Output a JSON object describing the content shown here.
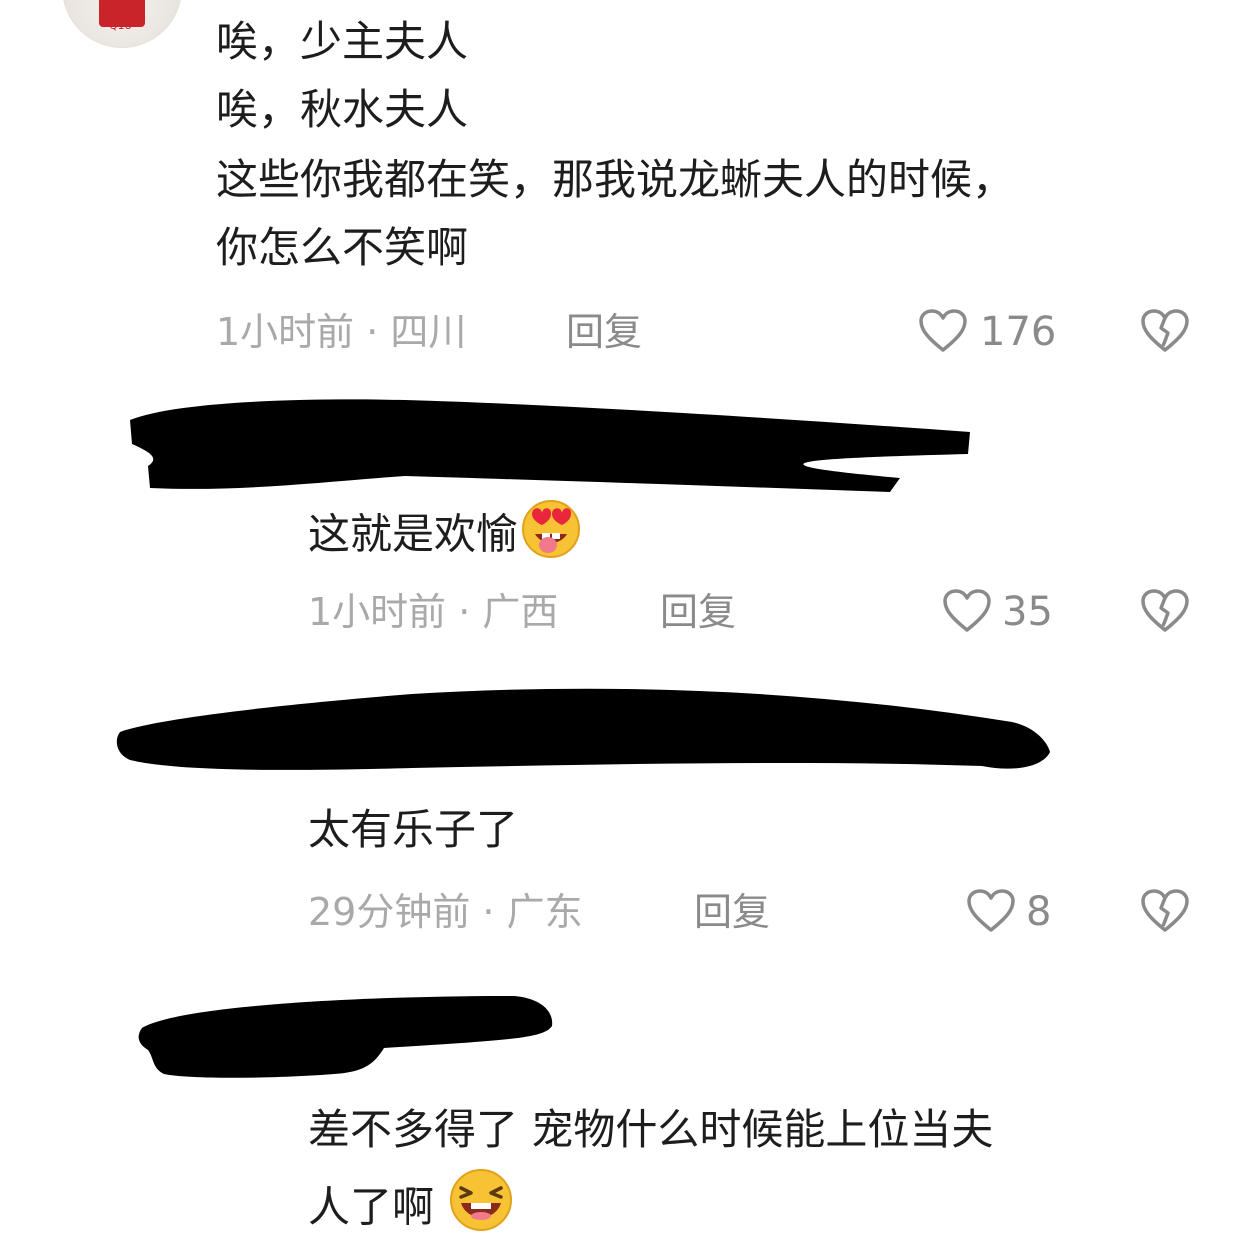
{
  "comment1": {
    "lines": [
      "唉，少主夫人",
      "唉，秋水夫人",
      "这些你我都在笑，那我说龙蜥夫人的时候，",
      "你怎么不笑啊"
    ],
    "meta": "1小时前 · 四川",
    "reply": "回复",
    "likes": "176",
    "avatar_tag": "Q18"
  },
  "reply1": {
    "text": "这就是欢愉",
    "meta": "1小时前 · 广西",
    "reply": "回复",
    "likes": "35"
  },
  "reply2": {
    "text": "太有乐子了",
    "meta": "29分钟前 · 广东",
    "reply": "回复",
    "likes": "8"
  },
  "reply3": {
    "lines": [
      "差不多得了 宠物什么时候能上位当夫",
      "人了啊"
    ]
  },
  "icons": {
    "like": "heart-outline-icon",
    "dislike": "broken-heart-icon",
    "emoji_love": "star-struck-tongue-emoji",
    "emoji_laugh": "laughing-emoji"
  }
}
